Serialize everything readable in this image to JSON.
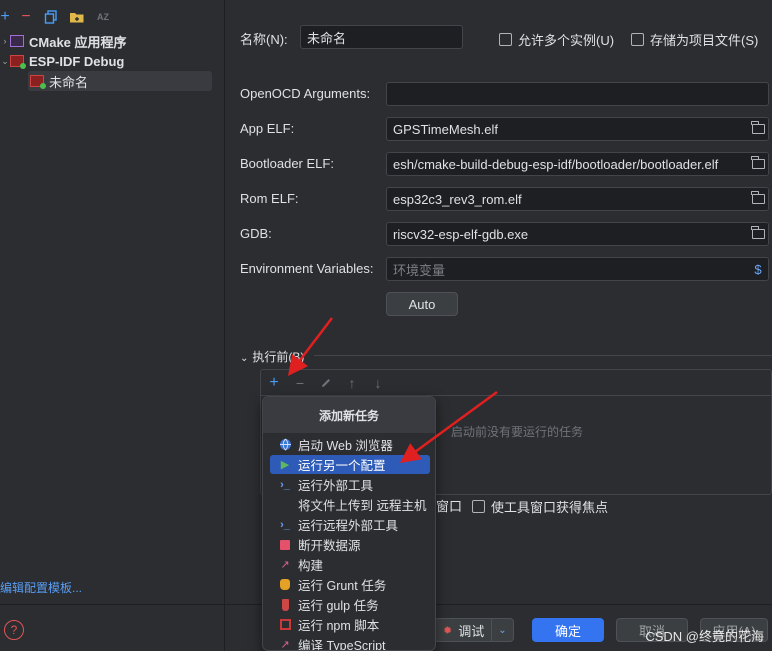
{
  "toolbar": {
    "add_icon": "plus-icon",
    "remove_icon": "minus-icon",
    "copy_icon": "copy-icon",
    "folder_icon": "new-folder-icon",
    "sort_icon": "sort-alpha-icon",
    "sort_label": "AZ"
  },
  "tree": {
    "cmake_label": "CMake 应用程序",
    "esp_label": "ESP-IDF Debug",
    "unnamed_label": "未命名"
  },
  "left_footer": {
    "edit_templates": "编辑配置模板...",
    "help": "?"
  },
  "form": {
    "name_label": "名称(N):",
    "name_value": "未命名",
    "allow_multiple": "允许多个实例(U)",
    "store_as_project": "存储为项目文件(S)",
    "openocd_label": "OpenOCD Arguments:",
    "openocd_value": "",
    "app_elf_label": "App ELF:",
    "app_elf_value": "GPSTimeMesh.elf",
    "bootloader_label": "Bootloader ELF:",
    "bootloader_value": "esh/cmake-build-debug-esp-idf/bootloader/bootloader.elf",
    "rom_label": "Rom ELF:",
    "rom_value": "esp32c3_rev3_rom.elf",
    "gdb_label": "GDB:",
    "gdb_value": "riscv32-esp-elf-gdb.exe",
    "env_label": "Environment Variables:",
    "env_placeholder": "环境变量",
    "env_icon": "$",
    "auto_button": "Auto"
  },
  "before_launch": {
    "title": "执行前(B)",
    "empty_text": "启动前没有要运行的任务",
    "show_window_partial": "窗口",
    "activate_tool_window": "使工具窗口获得焦点"
  },
  "popup": {
    "title": "添加新任务",
    "items": [
      {
        "label": "启动 Web 浏览器",
        "icon": "globe-icon"
      },
      {
        "label": "运行另一个配置",
        "icon": "play-icon"
      },
      {
        "label": "运行外部工具",
        "icon": "terminal-icon"
      },
      {
        "label": "将文件上传到 远程主机",
        "icon": ""
      },
      {
        "label": "运行远程外部工具",
        "icon": "terminal-icon"
      },
      {
        "label": "断开数据源",
        "icon": "stop-icon"
      },
      {
        "label": "构建",
        "icon": "hammer-icon"
      },
      {
        "label": "运行 Grunt 任务",
        "icon": "grunt-icon"
      },
      {
        "label": "运行 gulp 任务",
        "icon": "gulp-icon"
      },
      {
        "label": "运行 npm 脚本",
        "icon": "npm-icon"
      },
      {
        "label": "编译 TypeScript",
        "icon": "hammer-icon"
      }
    ]
  },
  "footer": {
    "debug_button": "调试",
    "ok_button": "确定",
    "cancel_button": "取消",
    "apply_button": "应用(A)"
  },
  "watermark": "CSDN @终竟的花海",
  "colors": {
    "accent": "#3574f0",
    "highlight": "#2e5bb8",
    "arrow": "#e02020",
    "background": "#2b2d30"
  }
}
